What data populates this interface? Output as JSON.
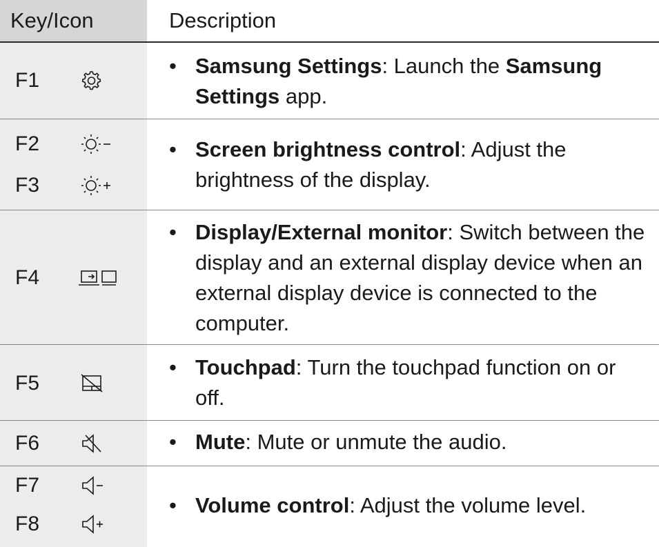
{
  "header": {
    "key_label": "Key/Icon",
    "desc_label": "Description"
  },
  "rows": [
    {
      "keys": [
        {
          "name": "F1",
          "icon": "gear-icon"
        }
      ],
      "term": "Samsung Settings",
      "sep": ": ",
      "text_pre": "Launch the ",
      "term2": "Samsung Settings",
      "text_post": " app."
    },
    {
      "keys": [
        {
          "name": "F2",
          "icon": "brightness-down-icon"
        },
        {
          "name": "F3",
          "icon": "brightness-up-icon"
        }
      ],
      "term": "Screen brightness control",
      "sep": ": ",
      "text": "Adjust the brightness of the display."
    },
    {
      "keys": [
        {
          "name": "F4",
          "icon": "display-switch-icon"
        }
      ],
      "term": "Display/External monitor",
      "sep": ": ",
      "text": "Switch between the display and an external display device when an external display device is connected to the computer."
    },
    {
      "keys": [
        {
          "name": "F5",
          "icon": "touchpad-off-icon"
        }
      ],
      "term": "Touchpad",
      "sep": ": ",
      "text": "Turn the touchpad function on or off."
    },
    {
      "keys": [
        {
          "name": "F6",
          "icon": "mute-icon"
        }
      ],
      "term": "Mute",
      "sep": ": ",
      "text": "Mute or unmute the audio."
    },
    {
      "keys": [
        {
          "name": "F7",
          "icon": "volume-down-icon"
        },
        {
          "name": "F8",
          "icon": "volume-up-icon"
        }
      ],
      "term": "Volume control",
      "sep": ": ",
      "text": "Adjust the volume level."
    }
  ],
  "bullet": "•",
  "colors": {
    "header_key_bg": "#d6d6d6",
    "key_col_bg": "#ececec",
    "text": "#1a1a1a"
  }
}
